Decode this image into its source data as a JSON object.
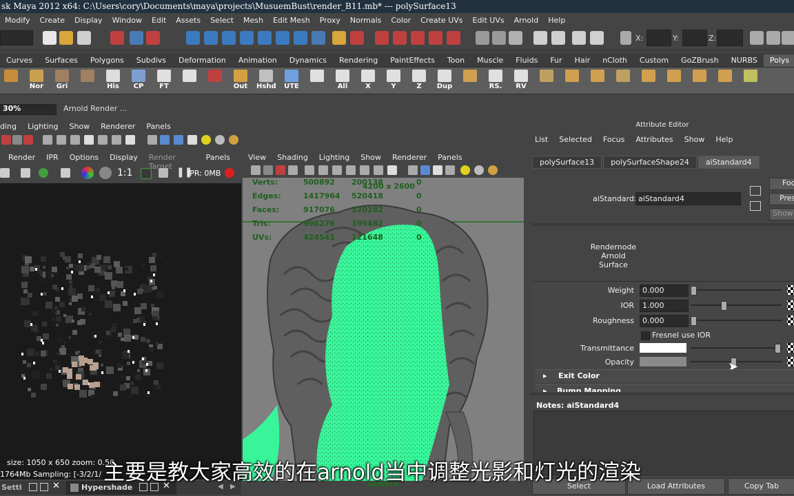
{
  "titlebar": {
    "text": "sk Maya 2012 x64: C:\\Users\\cory\\Documents\\maya\\projects\\MusuemBust\\render_B11.mb*  ---   polySurface13"
  },
  "menu": [
    "Modify",
    "Create",
    "Display",
    "Window",
    "Edit",
    "Assets",
    "Select",
    "Mesh",
    "Edit Mesh",
    "Proxy",
    "Normals",
    "Color",
    "Create UVs",
    "Edit UVs",
    "Arnold",
    "Help"
  ],
  "statusline": {
    "x_label": "X:",
    "y_label": "Y:",
    "z_label": "Z:"
  },
  "shelf_tabs": [
    "Curves",
    "Surfaces",
    "Polygons",
    "Subdivs",
    "Deformation",
    "Animation",
    "Dynamics",
    "Rendering",
    "PaintEffects",
    "Toon",
    "Muscle",
    "Fluids",
    "Fur",
    "Hair",
    "nCloth",
    "Custom",
    "GoZBrush",
    "NURBS",
    "Polys"
  ],
  "shelf_active": "Polys",
  "shelf_labels": [
    "Nor",
    "Gri",
    "His",
    "CP",
    "FT",
    "Out",
    "Hshd",
    "UTE",
    "All",
    "X",
    "Y",
    "Z",
    "Dup",
    "RS.",
    "RV"
  ],
  "progress": {
    "percent": "30%",
    "status": "Arnold Render ..."
  },
  "left_panel": {
    "menu1": [
      "ding",
      "Lighting",
      "Show",
      "Renderer",
      "Panels"
    ],
    "menu2": [
      "Render",
      "IPR",
      "Options",
      "Display",
      "Render Target",
      "Panels"
    ],
    "ratio": "1:1",
    "ipr": "IPR: 0MB",
    "status1": "size: 1050 x 650  zoom: 0.50",
    "status2": "1764Mb    Sampling: [-3/2/1/"
  },
  "viewport": {
    "menu": [
      "View",
      "Shading",
      "Lighting",
      "Show",
      "Renderer",
      "Panels"
    ],
    "resolution": "4200 x 2600",
    "hud": [
      {
        "label": "Verts:",
        "a": "500892",
        "b": "200138",
        "c": "0"
      },
      {
        "label": "Edges:",
        "a": "1417964",
        "b": "520418",
        "c": "0"
      },
      {
        "label": "Faces:",
        "a": "917076",
        "b": "320282",
        "c": "0"
      },
      {
        "label": "Tris:",
        "a": "996276",
        "b": "399482",
        "c": "0"
      },
      {
        "label": "UVs:",
        "a": "424541",
        "b": "121648",
        "c": "0"
      }
    ],
    "camera": "camera"
  },
  "attribute_editor": {
    "title": "Attribute Editor",
    "menu": [
      "List",
      "Selected",
      "Focus",
      "Attributes",
      "Show",
      "Help"
    ],
    "tabs": [
      "polySurface13",
      "polySurfaceShape24",
      "aiStandard4"
    ],
    "active_tab": "aiStandard4",
    "node_label": "aiStandard:",
    "node_value": "aiStandard4",
    "side_buttons": [
      "Foc",
      "Pres",
      "Show"
    ],
    "description": [
      "Rendernode",
      "Arnold",
      "Surface"
    ],
    "attrs": [
      {
        "label": "Weight",
        "value": "0.000",
        "slider": 0.0
      },
      {
        "label": "IOR",
        "value": "1.000",
        "slider": 0.33
      },
      {
        "label": "Roughness",
        "value": "0.000",
        "slider": 0.0
      }
    ],
    "fresnel_label": "Fresnel use IOR",
    "transmittance_label": "Transmittance",
    "transmittance_color": "#ffffff",
    "opacity_label": "Opacity",
    "opacity_color": "#8a8a8a",
    "sections": [
      "Exit Color",
      "Bump Mapping"
    ],
    "notes_label": "Notes:  aiStandard4",
    "buttons": [
      "Select",
      "Load Attributes",
      "Copy Tab"
    ]
  },
  "bottom_left": {
    "tab1": "Setti",
    "tab2": "Hypershade"
  },
  "subtitle": "主要是教大家高效的在arnold当中调整光影和灯光的渲染",
  "colors": {
    "green_mask": "#38f59a",
    "hud_green": "#1e5f1e",
    "titlebar": "#22313f"
  }
}
